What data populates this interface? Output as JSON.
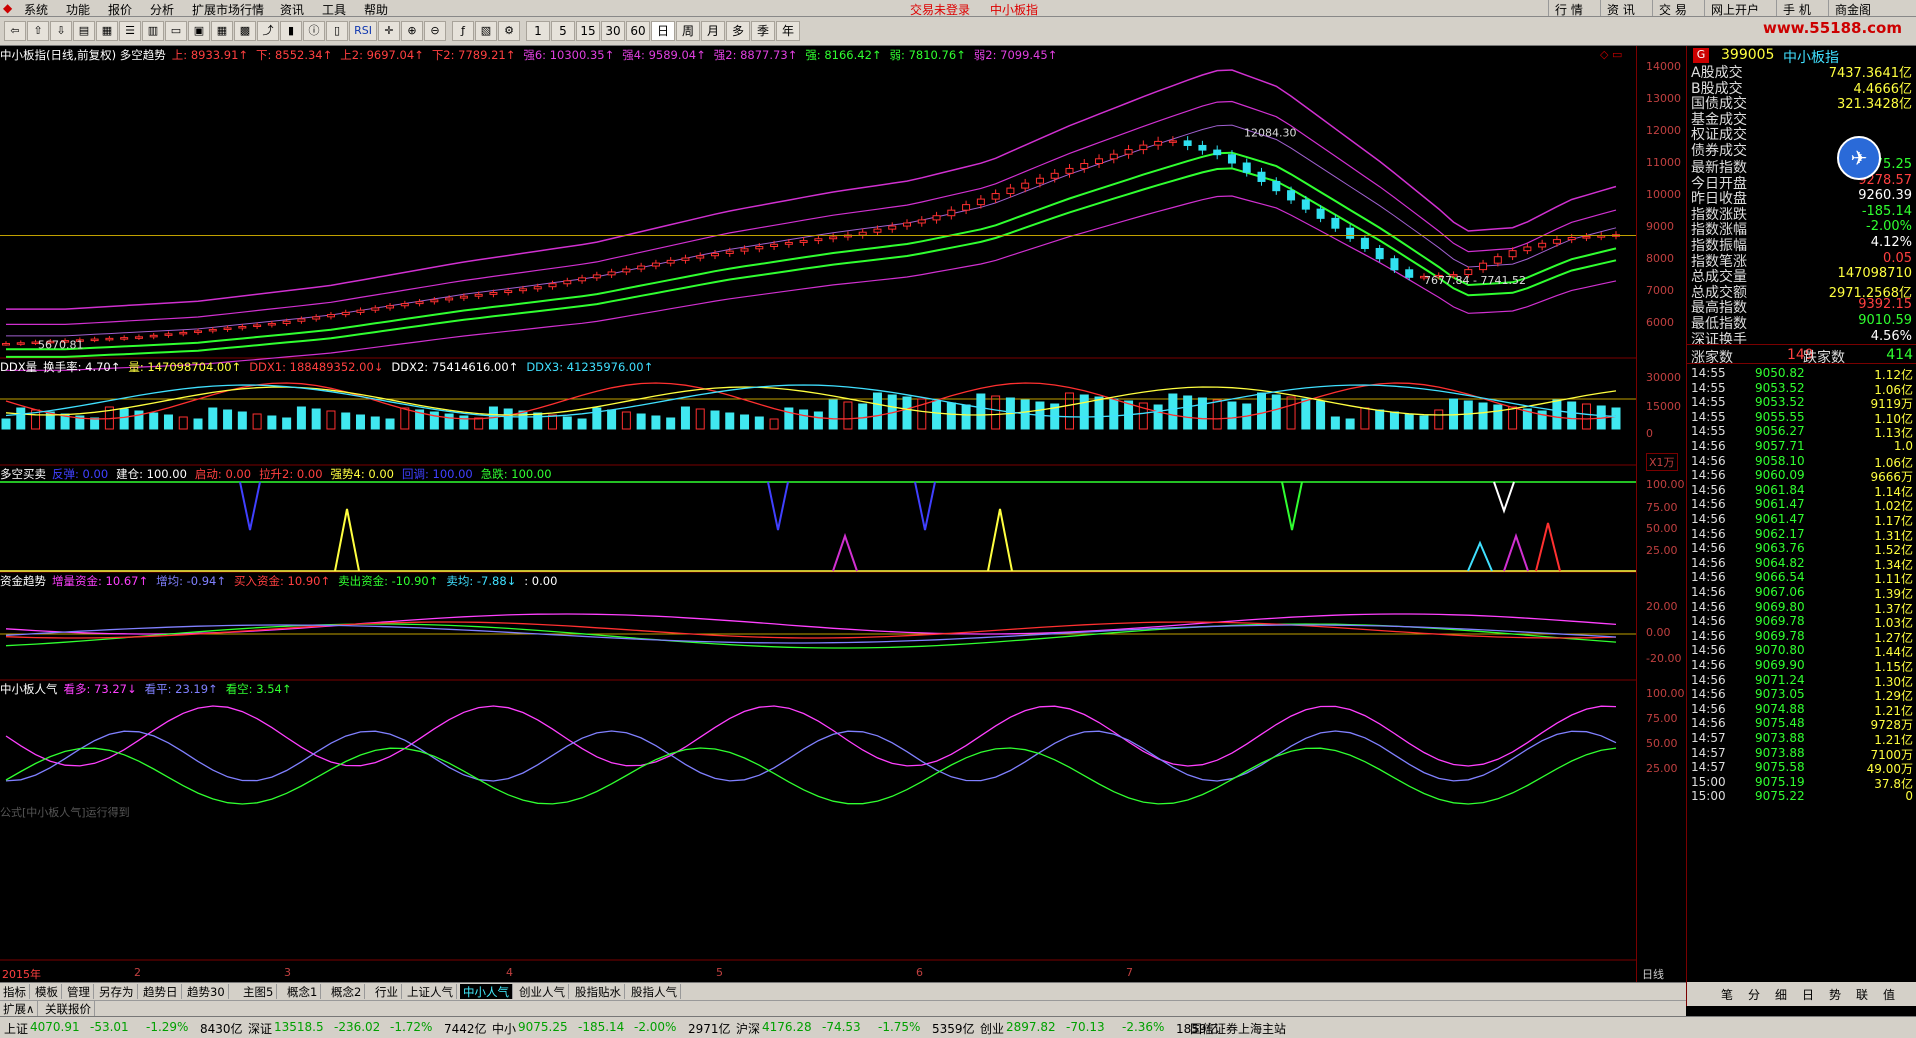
{
  "menu": {
    "items": [
      "系统",
      "功能",
      "报价",
      "分析",
      "扩展市场行情",
      "资讯",
      "工具",
      "帮助"
    ],
    "login": "交易未登录",
    "stock": "中小板指",
    "right": [
      "行 情",
      "资 讯",
      "交 易",
      "网上开户",
      "手 机",
      "商金阁"
    ]
  },
  "watermark": "www.55188.com",
  "toolbar": {
    "buttons": [
      "RSI"
    ],
    "periods": [
      "1",
      "5",
      "15",
      "30",
      "60",
      "日",
      "周",
      "月",
      "多",
      "季",
      "年"
    ]
  },
  "main": {
    "title": "中小板指(日线,前复权) 多空趋势",
    "params": [
      {
        "t": "上: 8933.91↑",
        "c": "#ff4040"
      },
      {
        "t": "下: 8552.34↑",
        "c": "#ff4040"
      },
      {
        "t": "上2: 9697.04↑",
        "c": "#ff4040"
      },
      {
        "t": "下2: 7789.21↑",
        "c": "#ff4040"
      },
      {
        "t": "强6: 10300.35↑",
        "c": "#e040e0"
      },
      {
        "t": "强4: 9589.04↑",
        "c": "#e040e0"
      },
      {
        "t": "强2: 8877.73↑",
        "c": "#e040e0"
      },
      {
        "t": "强: 8166.42↑",
        "c": "#30ff30"
      },
      {
        "t": "弱: 7810.76↑",
        "c": "#30ff30"
      },
      {
        "t": "弱2: 7099.45↑",
        "c": "#e040e0"
      }
    ],
    "y_ticks": [
      "14000",
      "13000",
      "12000",
      "11000",
      "10000",
      "9000",
      "8000",
      "7000",
      "6000"
    ],
    "hi_label": "12084.30",
    "lo_label": "7677.84 - 7741.52",
    "left_label": "5670.81"
  },
  "ddx": {
    "label": "DDX量",
    "params": [
      {
        "t": "换手率: 4.70↑",
        "c": "#ffffff"
      },
      {
        "t": "量: 147098704.00↑",
        "c": "#ffff40"
      },
      {
        "t": "DDX1: 188489352.00↓",
        "c": "#ff4040"
      },
      {
        "t": "DDX2: 75414616.00↑",
        "c": "#ffffff"
      },
      {
        "t": "DDX3: 41235976.00↑",
        "c": "#40e0ff"
      }
    ],
    "y_ticks": [
      "30000",
      "15000",
      "0"
    ],
    "unit": "X1万"
  },
  "ls": {
    "label": "多空买卖",
    "params": [
      {
        "t": "反弹: 0.00",
        "c": "#4040ff"
      },
      {
        "t": "建仓: 100.00",
        "c": "#ffffff"
      },
      {
        "t": "启动: 0.00",
        "c": "#ff4040"
      },
      {
        "t": "拉升2: 0.00",
        "c": "#ff4040"
      },
      {
        "t": "强势4: 0.00",
        "c": "#ffff40"
      },
      {
        "t": "回调: 100.00",
        "c": "#4040ff"
      },
      {
        "t": "急跌: 100.00",
        "c": "#30ff30"
      }
    ],
    "y_ticks": [
      "100.00",
      "75.00",
      "50.00",
      "25.00"
    ]
  },
  "fund": {
    "label": "资金趋势",
    "params": [
      {
        "t": "增量资金: 10.67↑",
        "c": "#ff40ff"
      },
      {
        "t": "增均: -0.94↑",
        "c": "#8080ff"
      },
      {
        "t": "买入资金: 10.90↑",
        "c": "#ff4040"
      },
      {
        "t": "卖出资金: -10.90↑",
        "c": "#30ff30"
      },
      {
        "t": "卖均: -7.88↓",
        "c": "#40e0ff"
      },
      {
        "t": ": 0.00",
        "c": "#ffffff"
      }
    ],
    "y_ticks": [
      "20.00",
      "0.00",
      "-20.00"
    ]
  },
  "pop": {
    "label": "中小板人气",
    "params": [
      {
        "t": "看多: 73.27↓",
        "c": "#ff40ff"
      },
      {
        "t": "看平: 23.19↑",
        "c": "#8080ff"
      },
      {
        "t": "看空: 3.54↑",
        "c": "#30ff30"
      }
    ],
    "y_ticks": [
      "100.00",
      "75.00",
      "50.00",
      "25.00"
    ],
    "overlay": "公式[中小板人气]运行得到"
  },
  "x_axis": {
    "labels": [
      "2015年",
      "2",
      "3",
      "4",
      "5",
      "6",
      "7"
    ],
    "unit": "日线"
  },
  "tabs": [
    "指标",
    "模板",
    "管理",
    "另存为",
    "趋势日",
    "趋势30",
    "主图5",
    "概念1",
    "概念2",
    "行业",
    "上证人气",
    "中小人气",
    "创业人气",
    "股指贴水",
    "股指人气"
  ],
  "tabs_row2": [
    "扩展∧",
    "关联报价"
  ],
  "rp": {
    "code": "399005",
    "name": "中小板指",
    "rows": [
      [
        "A股成交",
        "7437.3641亿",
        "#ffff40"
      ],
      [
        "B股成交",
        "4.4666亿",
        "#ffff40"
      ],
      [
        "国债成交",
        "321.3428亿",
        "#ffff40"
      ],
      [
        "基金成交",
        "",
        "#ffff40"
      ],
      [
        "权证成交",
        "",
        "#ffff40"
      ],
      [
        "债券成交",
        "",
        "#ffff40"
      ]
    ],
    "rows2": [
      [
        "最新指数",
        "9075.25",
        "#30ff30"
      ],
      [
        "今日开盘",
        "9278.57",
        "#ff4040"
      ],
      [
        "昨日收盘",
        "9260.39",
        "#ffffff"
      ],
      [
        "指数涨跌",
        "-185.14",
        "#30ff30"
      ],
      [
        "指数涨幅",
        "-2.00%",
        "#30ff30"
      ],
      [
        "指数振幅",
        "4.12%",
        "#ffffff"
      ],
      [
        "指数笔涨",
        "0.05",
        "#ff4040"
      ],
      [
        "总成交量",
        "147098710",
        "#ffff40"
      ],
      [
        "总成交额",
        "2971.2568亿",
        "#ffff40"
      ],
      [
        "最高指数",
        "9392.15",
        "#ff4040"
      ],
      [
        "最低指数",
        "9010.59",
        "#30ff30"
      ],
      [
        "深证换手",
        "4.56%",
        "#ffffff"
      ]
    ],
    "updown": {
      "up_label": "涨家数",
      "up": "149",
      "down_label": "跌家数",
      "down": "414"
    },
    "ticks": [
      [
        "14:55",
        "9050.82",
        "1.12亿"
      ],
      [
        "14:55",
        "9053.52",
        "1.06亿"
      ],
      [
        "14:55",
        "9053.52",
        "9119万"
      ],
      [
        "14:55",
        "9055.55",
        "1.10亿"
      ],
      [
        "14:55",
        "9056.27",
        "1.13亿"
      ],
      [
        "14:56",
        "9057.71",
        "1.0"
      ],
      [
        "14:56",
        "9058.10",
        "1.06亿"
      ],
      [
        "14:56",
        "9060.09",
        "9666万"
      ],
      [
        "14:56",
        "9061.84",
        "1.14亿"
      ],
      [
        "14:56",
        "9061.47",
        "1.02亿"
      ],
      [
        "14:56",
        "9061.47",
        "1.17亿"
      ],
      [
        "14:56",
        "9062.17",
        "1.31亿"
      ],
      [
        "14:56",
        "9063.76",
        "1.52亿"
      ],
      [
        "14:56",
        "9064.82",
        "1.34亿"
      ],
      [
        "14:56",
        "9066.54",
        "1.11亿"
      ],
      [
        "14:56",
        "9067.06",
        "1.39亿"
      ],
      [
        "14:56",
        "9069.80",
        "1.37亿"
      ],
      [
        "14:56",
        "9069.78",
        "1.03亿"
      ],
      [
        "14:56",
        "9069.78",
        "1.27亿"
      ],
      [
        "14:56",
        "9070.80",
        "1.44亿"
      ],
      [
        "14:56",
        "9069.90",
        "1.15亿"
      ],
      [
        "14:56",
        "9071.24",
        "1.30亿"
      ],
      [
        "14:56",
        "9073.05",
        "1.29亿"
      ],
      [
        "14:56",
        "9074.88",
        "1.21亿"
      ],
      [
        "14:56",
        "9075.48",
        "9728万"
      ],
      [
        "14:57",
        "9073.88",
        "1.21亿"
      ],
      [
        "14:57",
        "9073.88",
        "7100万"
      ],
      [
        "14:57",
        "9075.58",
        "49.00万"
      ],
      [
        "15:00",
        "9075.19",
        "37.8亿"
      ],
      [
        "15:00",
        "9075.22",
        "0"
      ]
    ],
    "bottom_tabs": [
      "笔",
      "分",
      "细",
      "日",
      "势",
      "联",
      "值"
    ]
  },
  "status": [
    {
      "l": "上证",
      "v": "4070.91",
      "c": "-53.01",
      "p": "-1.29%",
      "a": "8430亿"
    },
    {
      "l": "深证",
      "v": "13518.5",
      "c": "-236.02",
      "p": "-1.72%",
      "a": "7442亿"
    },
    {
      "l": "中小",
      "v": "9075.25",
      "c": "-185.14",
      "p": "-2.00%",
      "a": "2971亿"
    },
    {
      "l": "沪深",
      "v": "4176.28",
      "c": "-74.53",
      "p": "-1.75%",
      "a": "5359亿"
    },
    {
      "l": "创业",
      "v": "2897.82",
      "c": "-70.13",
      "p": "-2.36%",
      "a": "1859亿"
    }
  ],
  "broker": "国信证券上海主站",
  "colors": {
    "up": "#ff3030",
    "down": "#30e0f0",
    "bg": "#000000",
    "axis": "#7a0000"
  }
}
